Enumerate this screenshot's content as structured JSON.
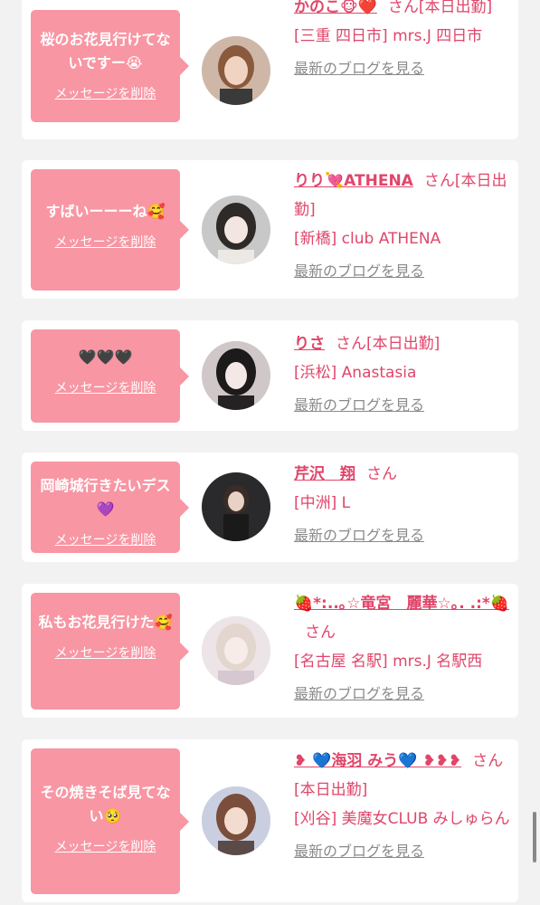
{
  "blog_link_label": "最新のブログを見る",
  "delete_label": "メッセージを削除",
  "colors": {
    "accent": "#e0466a",
    "bubble": "#f896a3",
    "background": "#f2f2f2",
    "card": "#ffffff"
  },
  "items": [
    {
      "message": "桜のお花見行けてないですー😭",
      "name": "かのこ🐵❤️",
      "suffix": "さん[本日出勤]",
      "shop": "[三重 四日市] mrs.J 四日市"
    },
    {
      "message": "すばいーーーね🥰",
      "name": "りり💘ATHENA",
      "suffix": "さん[本日出勤]",
      "shop": "[新橋] club ATHENA"
    },
    {
      "message": "🖤🖤🖤",
      "name": "りさ",
      "suffix": "さん[本日出勤]",
      "shop": "[浜松] Anastasia"
    },
    {
      "message": "岡崎城行きたいデス💜",
      "name": "芹沢　翔",
      "suffix": "さん",
      "shop": "[中洲] L"
    },
    {
      "message": "私もお花見行けた🥰",
      "name": "🍓*:..｡☆竜宮　麗華☆｡. .:*🍓",
      "suffix": "さん",
      "shop": "[名古屋 名駅] mrs.J 名駅西"
    },
    {
      "message": "その焼きそば見てない🥺",
      "name": "❥ 💙海羽 みう💙 ❥❥❥",
      "suffix": "さん[本日出勤]",
      "shop": "[刈谷] 美魔女CLUB みしゅらん"
    }
  ]
}
